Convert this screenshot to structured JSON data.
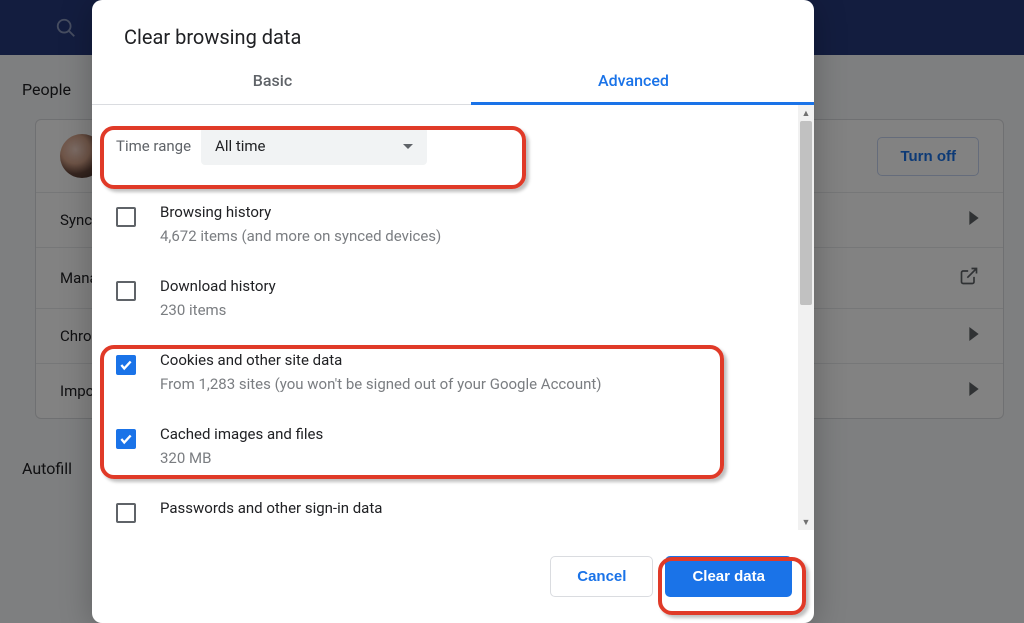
{
  "background": {
    "sections": {
      "people": "People",
      "autofill": "Autofill"
    },
    "turn_off": "Turn off",
    "rows": {
      "sync": "Sync",
      "manage": "Manage",
      "chrome": "Chrome",
      "import": "Import"
    }
  },
  "dialog": {
    "title": "Clear browsing data",
    "tabs": {
      "basic": "Basic",
      "advanced": "Advanced"
    },
    "time_range": {
      "label": "Time range",
      "value": "All time"
    },
    "items": [
      {
        "title": "Browsing history",
        "sub": "4,672 items (and more on synced devices)",
        "checked": false
      },
      {
        "title": "Download history",
        "sub": "230 items",
        "checked": false
      },
      {
        "title": "Cookies and other site data",
        "sub": "From 1,283 sites (you won't be signed out of your Google Account)",
        "checked": true
      },
      {
        "title": "Cached images and files",
        "sub": "320 MB",
        "checked": true
      },
      {
        "title": "Passwords and other sign-in data",
        "sub": "",
        "checked": false
      }
    ],
    "buttons": {
      "cancel": "Cancel",
      "clear": "Clear data"
    }
  }
}
